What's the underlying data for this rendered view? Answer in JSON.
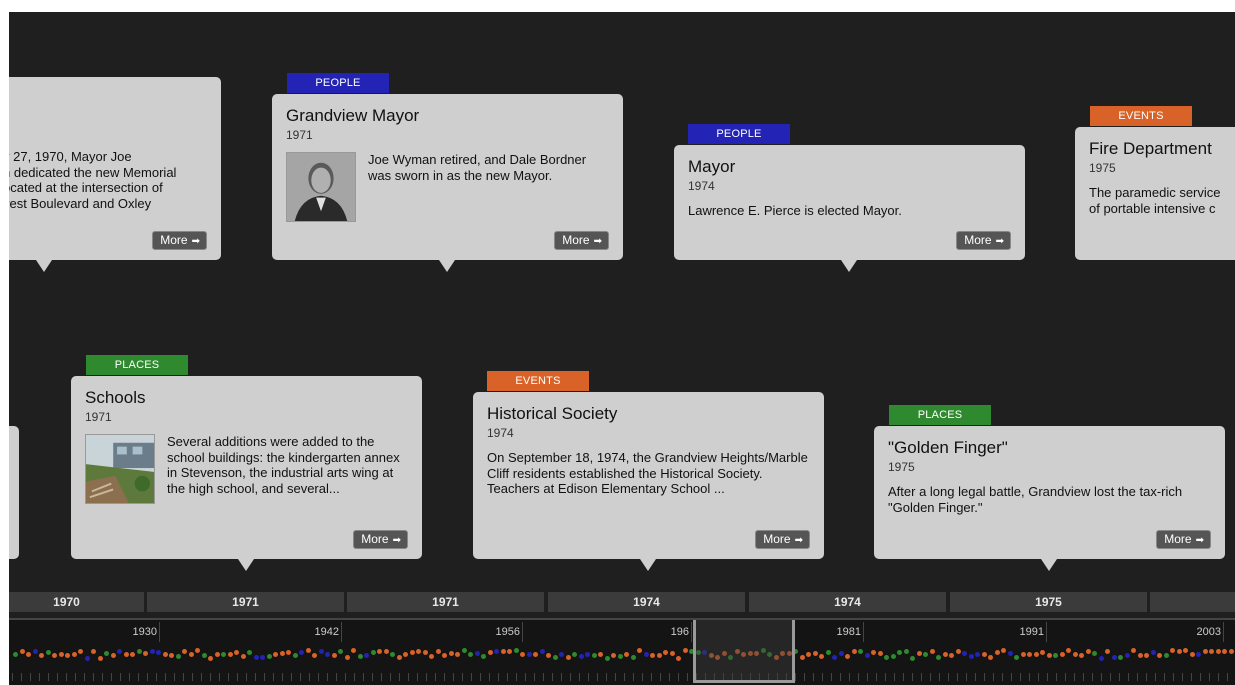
{
  "cards": [
    {
      "id": "memorial",
      "category": "",
      "title": "",
      "year": "",
      "body_lines": [
        "y 27, 1970, Mayor Joe",
        "n dedicated the new Memorial",
        "ocated at the intersection of",
        "vest Boulevard and Oxley"
      ],
      "more_label": "More"
    },
    {
      "id": "grandview-mayor",
      "category": "PEOPLE",
      "title": "Grandview Mayor",
      "year": "1971",
      "body": "Joe Wyman retired, and Dale Bordner was sworn in as the new Mayor.",
      "thumb": "portrait photo",
      "more_label": "More"
    },
    {
      "id": "mayor",
      "category": "PEOPLE",
      "title": "Mayor",
      "year": "1974",
      "body": "Lawrence E. Pierce is elected Mayor.",
      "more_label": "More"
    },
    {
      "id": "fire-department",
      "category": "EVENTS",
      "title": "Fire Department",
      "year": "1975",
      "body_lines": [
        "The paramedic service",
        "of portable intensive c"
      ]
    },
    {
      "id": "schools",
      "category": "PLACES",
      "title": "Schools",
      "year": "1971",
      "body": "Several additions were added to the school buildings: the kindergarten annex in Stevenson, the industrial arts wing at the high school, and several...",
      "thumb": "school building photo",
      "more_label": "More"
    },
    {
      "id": "historical-society",
      "category": "EVENTS",
      "title": "Historical Society",
      "year": "1974",
      "body": "On September 18, 1974, the Grandview Heights/Marble Cliff residents established the Historical Society. Teachers at Edison Elementary School ...",
      "more_label": "More"
    },
    {
      "id": "golden-finger",
      "category": "PLACES",
      "title": "\"Golden Finger\"",
      "year": "1975",
      "body": "After a long legal battle, Grandview lost the tax-rich \"Golden Finger.\"",
      "more_label": "More"
    }
  ],
  "date_bar": [
    "1970",
    "1971",
    "1971",
    "1974",
    "1974",
    "1975",
    ""
  ],
  "navigator": {
    "labels": [
      "1930",
      "1942",
      "1956",
      "196",
      "1981",
      "1991",
      "2003"
    ],
    "marker_colors": [
      "#d86228",
      "#2f8a2f",
      "#2323b5"
    ]
  },
  "colors": {
    "people": "#2323b5",
    "places": "#2f8a2f",
    "events": "#d86228"
  }
}
